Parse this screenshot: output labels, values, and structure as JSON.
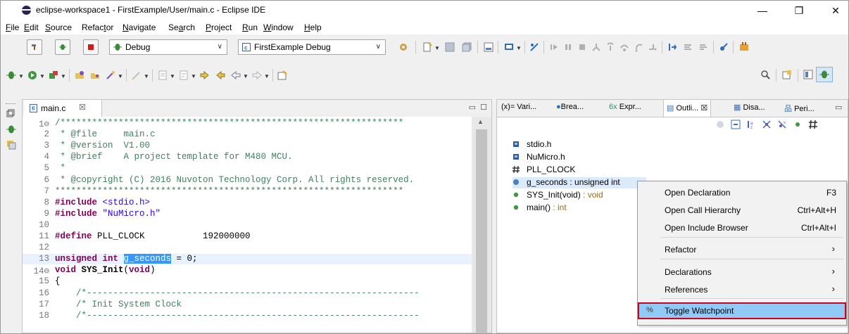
{
  "window": {
    "title": "eclipse-workspace1 - FirstExample/User/main.c - Eclipse IDE",
    "controls": [
      "—",
      "❐",
      "✕"
    ]
  },
  "menu": [
    {
      "pre": "",
      "u": "F",
      "post": "ile"
    },
    {
      "pre": "",
      "u": "E",
      "post": "dit"
    },
    {
      "pre": "",
      "u": "S",
      "post": "ource"
    },
    {
      "pre": "Refac",
      "u": "t",
      "post": "or"
    },
    {
      "pre": "",
      "u": "N",
      "post": "avigate"
    },
    {
      "pre": "Se",
      "u": "a",
      "post": "rch"
    },
    {
      "pre": "",
      "u": "P",
      "post": "roject"
    },
    {
      "pre": "",
      "u": "R",
      "post": "un"
    },
    {
      "pre": "",
      "u": "W",
      "post": "indow"
    },
    {
      "pre": "",
      "u": "H",
      "post": "elp"
    }
  ],
  "toolbar": {
    "launch_mode": "Debug",
    "launch_config": "FirstExample Debug"
  },
  "editor": {
    "tab_label": "main.c",
    "tab_close": "☒",
    "lines": [
      {
        "n": "1⊖",
        "segs": [
          {
            "c": "cmt",
            "t": "/*****************************************************************"
          }
        ]
      },
      {
        "n": "2",
        "segs": [
          {
            "c": "cmt",
            "t": " * @file     main.c"
          }
        ]
      },
      {
        "n": "3",
        "segs": [
          {
            "c": "cmt",
            "t": " * @version  V1.00"
          }
        ]
      },
      {
        "n": "4",
        "segs": [
          {
            "c": "cmt",
            "t": " * @brief    A project template for M480 MCU."
          }
        ]
      },
      {
        "n": "5",
        "segs": [
          {
            "c": "cmt",
            "t": " *"
          }
        ]
      },
      {
        "n": "6",
        "segs": [
          {
            "c": "cmt",
            "t": " * @copyright (C) 2016 Nuvoton Technology Corp. All rights reserved."
          }
        ]
      },
      {
        "n": "7",
        "segs": [
          {
            "c": "cmt",
            "t": "******************************************************************"
          }
        ]
      },
      {
        "n": "8",
        "segs": [
          {
            "c": "kw",
            "t": "#include "
          },
          {
            "c": "str",
            "t": "<stdio.h>"
          }
        ]
      },
      {
        "n": "9",
        "segs": [
          {
            "c": "kw",
            "t": "#include "
          },
          {
            "c": "str",
            "t": "\"NuMicro.h\""
          }
        ]
      },
      {
        "n": "10",
        "segs": []
      },
      {
        "n": "11",
        "segs": [
          {
            "c": "kw",
            "t": "#define "
          },
          {
            "c": "",
            "t": "PLL_CLOCK           192000000"
          }
        ]
      },
      {
        "n": "12",
        "segs": []
      },
      {
        "n": "13",
        "segs": [
          {
            "c": "kw",
            "t": "unsigned int "
          },
          {
            "c": "sel",
            "t": "g_seconds"
          },
          {
            "c": "",
            "t": " = 0;"
          }
        ]
      },
      {
        "n": "14⊖",
        "segs": [
          {
            "c": "kw",
            "t": "void "
          },
          {
            "c": "b",
            "t": "SYS_Init"
          },
          {
            "c": "",
            "t": "("
          },
          {
            "c": "kw",
            "t": "void"
          },
          {
            "c": "",
            "t": ")"
          }
        ]
      },
      {
        "n": "15",
        "segs": [
          {
            "c": "",
            "t": "{"
          }
        ]
      },
      {
        "n": "16",
        "segs": [
          {
            "c": "cmt",
            "t": "    /*---------------------------------------------------------------"
          }
        ]
      },
      {
        "n": "17",
        "segs": [
          {
            "c": "cmt",
            "t": "    /* Init System Clock"
          }
        ]
      },
      {
        "n": "18",
        "segs": [
          {
            "c": "cmt",
            "t": "    /*---------------------------------------------------------------"
          }
        ]
      }
    ]
  },
  "views": {
    "tabs": [
      "(x)= Vari...",
      "Brea...",
      "Expr...",
      "Outli...",
      "Disa...",
      "Peri..."
    ],
    "active_close": "☒"
  },
  "outline": [
    {
      "kind": "include",
      "name": "stdio.h",
      "type": ""
    },
    {
      "kind": "include",
      "name": "NuMicro.h",
      "type": ""
    },
    {
      "kind": "macro",
      "name": "PLL_CLOCK",
      "type": ""
    },
    {
      "kind": "variable",
      "name": "g_seconds : unsigned int",
      "type": ""
    },
    {
      "kind": "function",
      "name": "SYS_Init(void)",
      "type": " : void"
    },
    {
      "kind": "function",
      "name": "main()",
      "type": " : int"
    }
  ],
  "context_menu": [
    {
      "label": "Open Declaration",
      "shortcut": "F3",
      "submenu": false
    },
    {
      "label": "Open Call Hierarchy",
      "shortcut": "Ctrl+Alt+H",
      "submenu": false
    },
    {
      "label": "Open Include Browser",
      "shortcut": "Ctrl+Alt+I",
      "submenu": false
    },
    {
      "label": "Refactor",
      "shortcut": "",
      "submenu": true
    },
    {
      "label": "Declarations",
      "shortcut": "",
      "submenu": true
    },
    {
      "label": "References",
      "shortcut": "",
      "submenu": true
    },
    {
      "label": "Toggle Watchpoint",
      "shortcut": "",
      "submenu": false
    }
  ],
  "submenu_arrow": "›",
  "watch_icon_glyph": "%"
}
